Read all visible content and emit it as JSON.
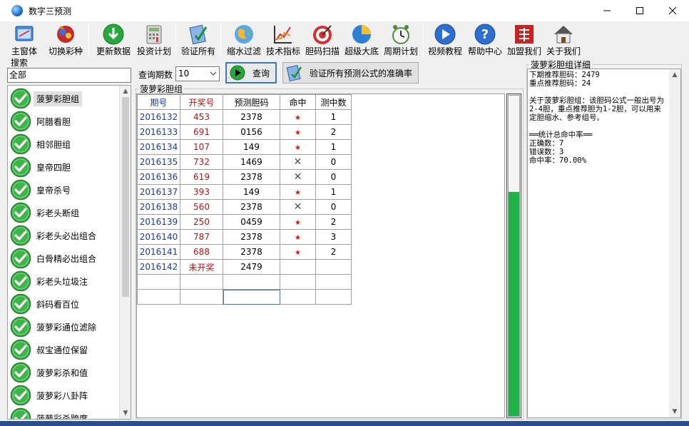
{
  "window": {
    "title": "数字三预测"
  },
  "toolbar": [
    {
      "id": "main",
      "label": "主窗体",
      "icon": "window-icon"
    },
    {
      "id": "switch",
      "label": "切换彩种",
      "icon": "lottery-ball-icon"
    },
    {
      "id": "update",
      "label": "更新数据",
      "icon": "download-icon"
    },
    {
      "id": "plan",
      "label": "投资计划",
      "icon": "calculator-icon"
    },
    {
      "id": "verify",
      "label": "验证所有",
      "icon": "verify-icon"
    },
    {
      "id": "filter",
      "label": "缩水过滤",
      "icon": "globe-icon"
    },
    {
      "id": "tech",
      "label": "技术指标",
      "icon": "chart-icon"
    },
    {
      "id": "scan",
      "label": "胆码扫描",
      "icon": "target-icon"
    },
    {
      "id": "bottom",
      "label": "超级大底",
      "icon": "pie-icon"
    },
    {
      "id": "cycle",
      "label": "周期计划",
      "icon": "clock-icon"
    },
    {
      "id": "video",
      "label": "视频教程",
      "icon": "play-icon"
    },
    {
      "id": "help",
      "label": "帮助中心",
      "icon": "help-icon"
    },
    {
      "id": "join",
      "label": "加盟我们",
      "icon": "join-icon"
    },
    {
      "id": "about",
      "label": "关于我们",
      "icon": "house-icon"
    }
  ],
  "search": {
    "label": "搜索",
    "value": "全部"
  },
  "formulas": [
    "菠萝彩胆组",
    "阿腊看胆",
    "相邻胆组",
    "皇帝四胆",
    "皇帝杀号",
    "彩老头断组",
    "彩老头必出组合",
    "白骨精必出组合",
    "彩老头垃圾注",
    "斜码看百位",
    "菠萝彩通位滤除",
    "叔宝通位保留",
    "菠萝彩杀和值",
    "菠萝彩八卦阵",
    "菠萝彩杀跨度"
  ],
  "query": {
    "label": "查询期数",
    "value": "10",
    "button": "查询",
    "verify_button": "验证所有预测公式的准确率"
  },
  "group": {
    "title": "菠萝彩胆组",
    "columns": [
      "期号",
      "开奖号",
      "预测胆码",
      "命中",
      "测中数"
    ],
    "rows": [
      {
        "period": "2016132",
        "draw": "453",
        "pred": "2378",
        "hit": "★",
        "count": "1"
      },
      {
        "period": "2016133",
        "draw": "691",
        "pred": "0156",
        "hit": "★",
        "count": "2"
      },
      {
        "period": "2016134",
        "draw": "107",
        "pred": "149",
        "hit": "★",
        "count": "1"
      },
      {
        "period": "2016135",
        "draw": "732",
        "pred": "1469",
        "hit": "✕",
        "count": "0"
      },
      {
        "period": "2016136",
        "draw": "619",
        "pred": "2378",
        "hit": "✕",
        "count": "0"
      },
      {
        "period": "2016137",
        "draw": "393",
        "pred": "149",
        "hit": "★",
        "count": "1"
      },
      {
        "period": "2016138",
        "draw": "560",
        "pred": "2378",
        "hit": "✕",
        "count": "0"
      },
      {
        "period": "2016139",
        "draw": "250",
        "pred": "0459",
        "hit": "★",
        "count": "2"
      },
      {
        "period": "2016140",
        "draw": "787",
        "pred": "2378",
        "hit": "★",
        "count": "3"
      },
      {
        "period": "2016141",
        "draw": "688",
        "pred": "2378",
        "hit": "★",
        "count": "2"
      },
      {
        "period": "2016142",
        "draw": "未开奖",
        "pred": "2479",
        "hit": "",
        "count": ""
      }
    ],
    "progress_fraction": 0.7
  },
  "detail": {
    "title": "菠萝彩胆组详细",
    "text": "下期推荐胆码：2479\n重点推荐胆码：24\n\n关于菠萝彩胆组：该胆码公式一般出号为2-4胆，重点推荐胆为1-2胆，可以用来定胆缩水、参考组号。\n\n══统计总命中率══\n正确数：7\n错误数：3\n命中率：70.00%"
  },
  "colors": {
    "period": "#1a3aa8",
    "draw": "#c01010",
    "hit_star": "#e01010",
    "progress": "#1fb34a"
  }
}
